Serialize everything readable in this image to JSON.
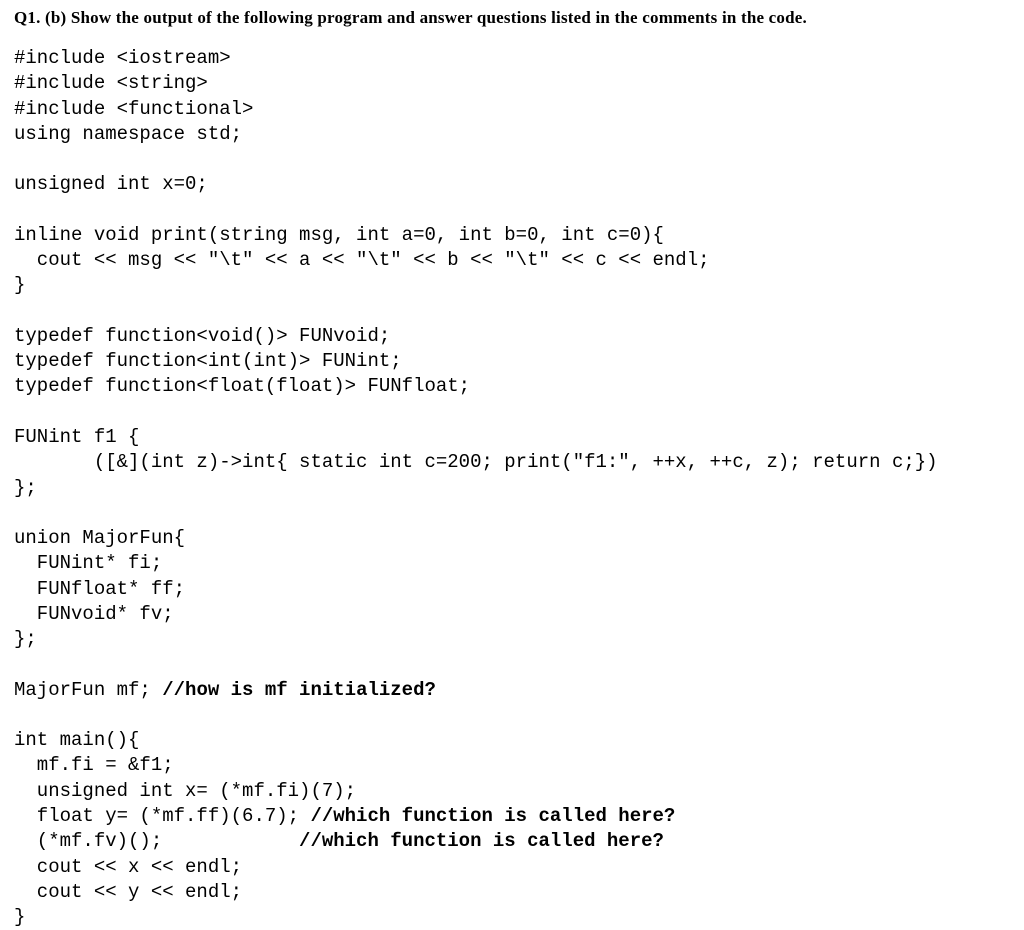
{
  "question": {
    "label": "Q1. (b) Show the output of the following program and answer questions listed in the comments in the code."
  },
  "code": {
    "line01": "#include <iostream>",
    "line02": "#include <string>",
    "line03": "#include <functional>",
    "line04": "using namespace std;",
    "blank1": "",
    "line05": "unsigned int x=0;",
    "blank2": "",
    "line06": "inline void print(string msg, int a=0, int b=0, int c=0){",
    "line07": "  cout << msg << \"\\t\" << a << \"\\t\" << b << \"\\t\" << c << endl;",
    "line08": "}",
    "blank3": "",
    "line09": "typedef function<void()> FUNvoid;",
    "line10": "typedef function<int(int)> FUNint;",
    "line11": "typedef function<float(float)> FUNfloat;",
    "blank4": "",
    "line12": "FUNint f1 {",
    "line13": "       ([&](int z)->int{ static int c=200; print(\"f1:\", ++x, ++c, z); return c;})",
    "line14": "};",
    "blank5": "",
    "line15": "union MajorFun{",
    "line16": "  FUNint* fi;",
    "line17": "  FUNfloat* ff;",
    "line18": "  FUNvoid* fv;",
    "line19": "};",
    "blank6": "",
    "line20a": "MajorFun mf; ",
    "line20b": "//how is mf initialized?",
    "blank7": "",
    "line21": "int main(){",
    "line22": "  mf.fi = &f1;",
    "line23": "  unsigned int x= (*mf.fi)(7);",
    "line24a": "  float y= (*mf.ff)(6.7); ",
    "line24b": "//which function is called here?",
    "line25a": "  (*mf.fv)();            ",
    "line25b": "//which function is called here?",
    "line26": "  cout << x << endl;",
    "line27": "  cout << y << endl;",
    "line28": "}"
  }
}
